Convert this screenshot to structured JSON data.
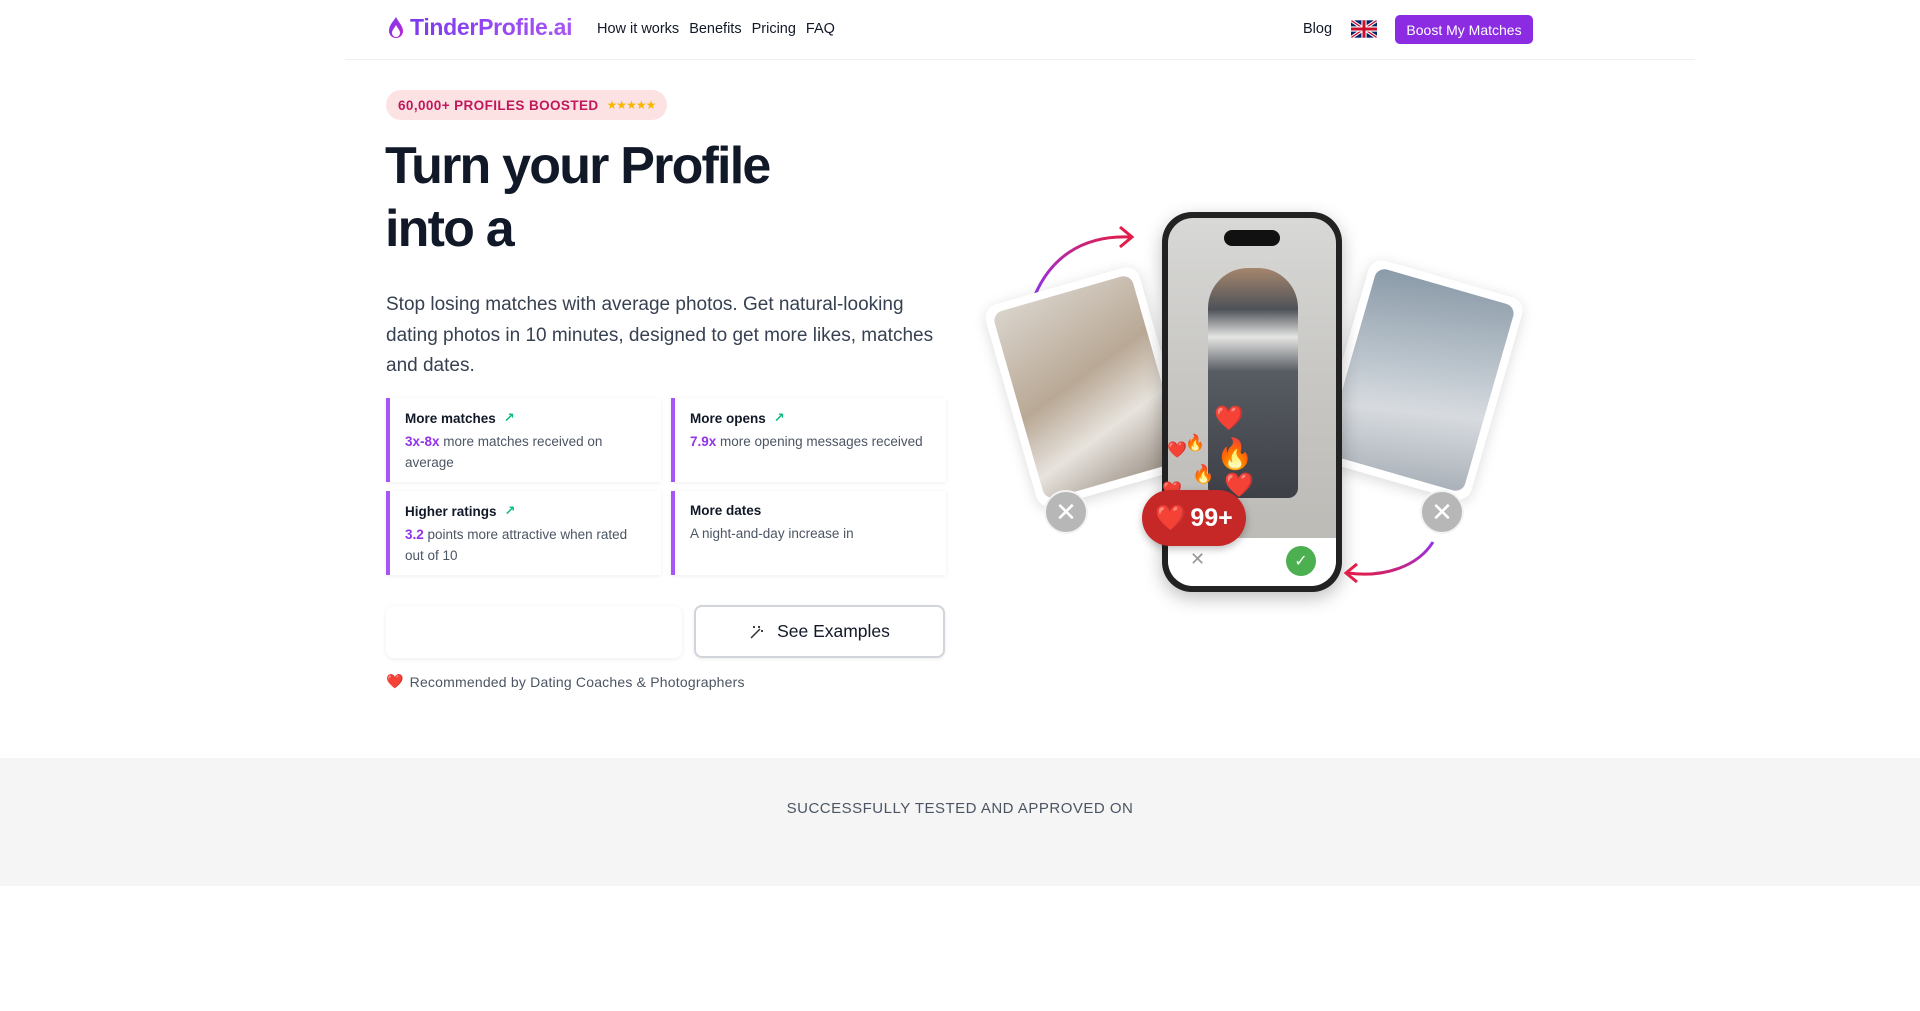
{
  "nav": {
    "logo_text": "TinderProfile.ai",
    "links": [
      "How it works",
      "Benefits",
      "Pricing",
      "FAQ"
    ],
    "blog": "Blog",
    "cta": "Boost My Matches",
    "language_icon": "uk-flag-icon"
  },
  "hero": {
    "badge": "60,000+ PROFILES BOOSTED",
    "badge_stars": "★★★★★",
    "title_line1": "Turn your Profile",
    "title_line2": "into a",
    "subtitle": "Stop losing matches with average photos. Get natural-looking dating photos in 10 minutes, designed to get more likes, matches and dates.",
    "benefits": [
      {
        "title": "More matches",
        "highlight": "3x-8x",
        "text": " more matches received on average",
        "trend": true
      },
      {
        "title": "More opens",
        "highlight": "7.9x",
        "text": " more opening messages received",
        "trend": true
      },
      {
        "title": "Higher ratings",
        "highlight": "3.2",
        "text": " points more attractive when rated out of 10",
        "trend": true
      },
      {
        "title": "More dates",
        "highlight": "",
        "text": "A night-and-day increase in",
        "trend": false
      }
    ],
    "primary_button": "",
    "examples_button": "See Examples",
    "recommend": "Recommended by Dating Coaches & Photographers",
    "recommend_icon": "❤️"
  },
  "visual": {
    "counter": "99+",
    "counter_icon": "❤️"
  },
  "proof": {
    "label": "SUCCESSFULLY TESTED AND APPROVED ON"
  },
  "colors": {
    "brand": "#8b2be2",
    "accent_border": "#a855f7",
    "highlight": "#9333ea",
    "badge_bg": "#fde2e4",
    "badge_text": "#c2185b"
  }
}
